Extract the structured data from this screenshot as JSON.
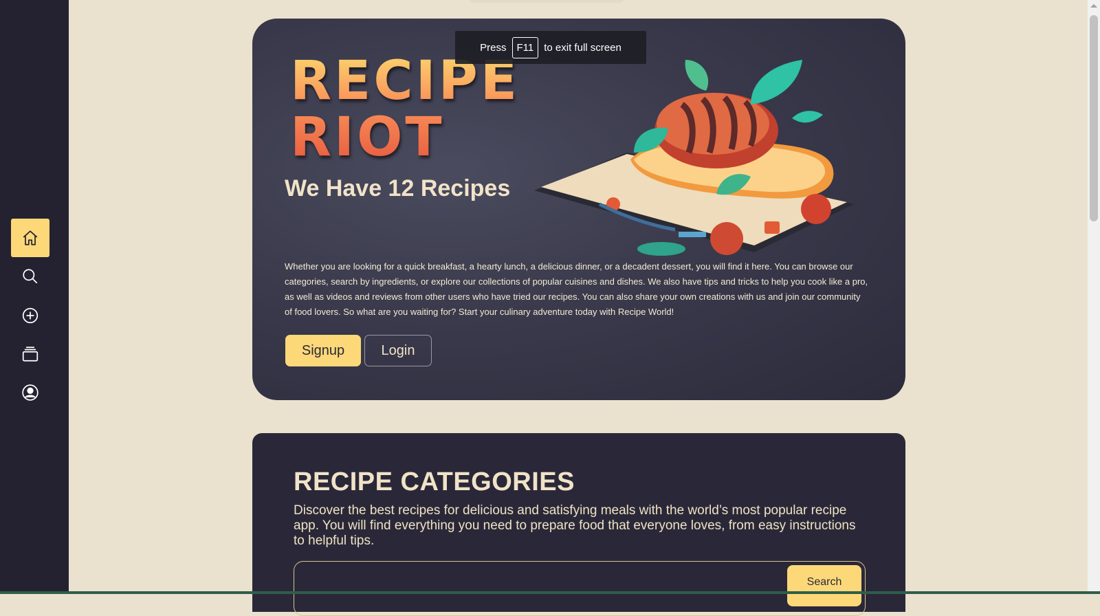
{
  "sidebar": {
    "items": [
      {
        "name": "home",
        "icon": "home-icon",
        "active": true
      },
      {
        "name": "search",
        "icon": "search-icon",
        "active": false
      },
      {
        "name": "add",
        "icon": "plus-circle-icon",
        "active": false
      },
      {
        "name": "collections",
        "icon": "stack-icon",
        "active": false
      },
      {
        "name": "profile",
        "icon": "user-circle-icon",
        "active": false
      }
    ]
  },
  "hero": {
    "title": "RECIPE\nRIOT",
    "recipe_count": "We Have 12 Recipes",
    "description": "Whether you are looking for a quick breakfast, a hearty lunch, a delicious dinner, or a decadent dessert, you will find it here. You can browse our categories, search by ingredients, or explore our collections of popular cuisines and dishes. We also have tips and tricks to help you cook like a pro, as well as videos and reviews from other users who have tried our recipes. You can also share your own creations with us and join our community of food lovers. So what are you waiting for? Start your culinary adventure today with Recipe World!",
    "signup_label": "Signup",
    "login_label": "Login"
  },
  "fullscreen_notice": {
    "prefix": "Press",
    "key": "F11",
    "suffix": "to exit full screen"
  },
  "categories": {
    "title": "RECIPE CATEGORIES",
    "description": "Discover the best recipes for delicious and satisfying meals with the world’s most popular recipe app. You will find everything you need to prepare food that everyone loves, from easy instructions to helpful tips.",
    "search_placeholder": "",
    "search_label": "Search"
  },
  "colors": {
    "accent": "#fcd878",
    "sidebar": "#242231",
    "page_bg": "#eae2cf",
    "hero_bg": "#3a3a4c"
  }
}
